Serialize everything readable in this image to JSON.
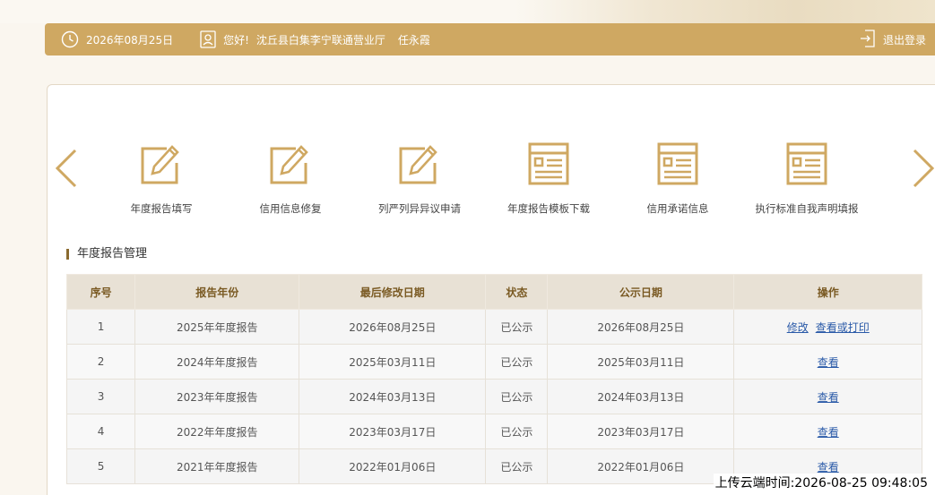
{
  "header": {
    "date": "2026年08月25日",
    "greeting": "您好!",
    "org": "沈丘县白集李宁联通营业厅",
    "user": "任永霞",
    "logout_label": "退出登录"
  },
  "shortcuts": [
    {
      "label": "年度报告填写",
      "icon": "edit-icon"
    },
    {
      "label": "信用信息修复",
      "icon": "edit-icon"
    },
    {
      "label": "列严列异异议申请",
      "icon": "edit-icon"
    },
    {
      "label": "年度报告模板下载",
      "icon": "document-icon"
    },
    {
      "label": "信用承诺信息",
      "icon": "document-icon"
    },
    {
      "label": "执行标准自我声明填报",
      "icon": "document-icon"
    }
  ],
  "section_title": "年度报告管理",
  "table": {
    "headers": [
      "序号",
      "报告年份",
      "最后修改日期",
      "状态",
      "公示日期",
      "操作"
    ],
    "rows": [
      {
        "no": "1",
        "year": "2025年年度报告",
        "modified": "2026年08月25日",
        "status": "已公示",
        "pub": "2026年08月25日",
        "actions": [
          "修改",
          "查看或打印"
        ]
      },
      {
        "no": "2",
        "year": "2024年年度报告",
        "modified": "2025年03月11日",
        "status": "已公示",
        "pub": "2025年03月11日",
        "actions": [
          "查看"
        ]
      },
      {
        "no": "3",
        "year": "2023年年度报告",
        "modified": "2024年03月13日",
        "status": "已公示",
        "pub": "2024年03月13日",
        "actions": [
          "查看"
        ]
      },
      {
        "no": "4",
        "year": "2022年年度报告",
        "modified": "2023年03月17日",
        "status": "已公示",
        "pub": "2023年03月17日",
        "actions": [
          "查看"
        ]
      },
      {
        "no": "5",
        "year": "2021年年度报告",
        "modified": "2022年01月06日",
        "status": "已公示",
        "pub": "2022年01月06日",
        "actions": [
          "查看"
        ]
      }
    ]
  },
  "watermark": "上传云端时间:2026-08-25 09:48:05",
  "colors": {
    "accent": "#cfa862",
    "link": "#2a5aa8",
    "header_text": "#7a5a23"
  }
}
